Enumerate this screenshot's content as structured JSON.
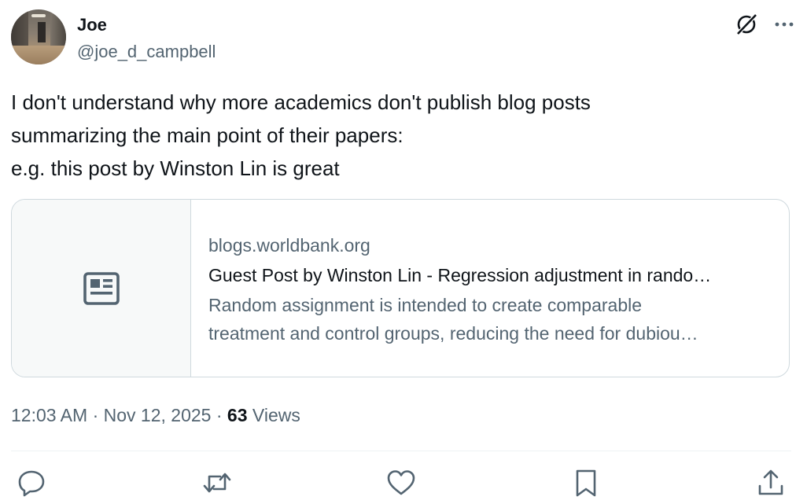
{
  "author": {
    "name": "Joe",
    "handle": "@joe_d_campbell",
    "avatar_icon": "profile-photo"
  },
  "header_icons": {
    "grok": "grok-icon",
    "more": "more-icon"
  },
  "post": {
    "lines": [
      "I don't understand why more academics don't publish blog posts",
      "summarizing the main point of their papers:",
      "e.g. this post by Winston Lin is great"
    ]
  },
  "link_card": {
    "thumbnail_icon": "article-icon",
    "domain": "blogs.worldbank.org",
    "title": "Guest Post by Winston Lin - Regression adjustment in rando…",
    "description_lines": [
      "Random assignment is intended to create comparable",
      "treatment and control groups, reducing the need for dubiou…"
    ]
  },
  "meta": {
    "time": "12:03 AM",
    "separator": " · ",
    "date": "Nov 12, 2025",
    "views_count": "63",
    "views_label": " Views"
  },
  "actions": [
    {
      "name": "reply",
      "icon": "reply-icon"
    },
    {
      "name": "repost",
      "icon": "repost-icon"
    },
    {
      "name": "like",
      "icon": "like-icon"
    },
    {
      "name": "bookmark",
      "icon": "bookmark-icon"
    },
    {
      "name": "share",
      "icon": "share-icon"
    }
  ],
  "colors": {
    "text_primary": "#0f1419",
    "text_secondary": "#536471",
    "border": "#cfd9de",
    "thumb_bg": "#f7f9f9"
  }
}
